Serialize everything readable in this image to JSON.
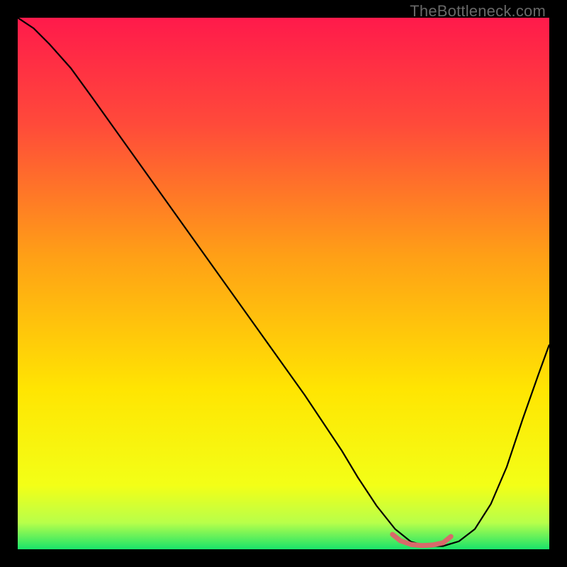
{
  "watermark": "TheBottleneck.com",
  "chart_data": {
    "type": "line",
    "title": "",
    "xlabel": "",
    "ylabel": "",
    "xlim": [
      0,
      100
    ],
    "ylim": [
      0,
      100
    ],
    "background_gradient": {
      "stops": [
        {
          "offset": 0.0,
          "color": "#ff1a4b"
        },
        {
          "offset": 0.2,
          "color": "#ff4a3a"
        },
        {
          "offset": 0.45,
          "color": "#ffa016"
        },
        {
          "offset": 0.7,
          "color": "#ffe502"
        },
        {
          "offset": 0.88,
          "color": "#f3ff17"
        },
        {
          "offset": 0.95,
          "color": "#b8ff4a"
        },
        {
          "offset": 1.0,
          "color": "#19e36a"
        }
      ]
    },
    "series": [
      {
        "name": "bottleneck-curve",
        "color": "#000000",
        "width": 2.2,
        "x": [
          0,
          3,
          6,
          10,
          14,
          18,
          22,
          26,
          30,
          34,
          38,
          42,
          46,
          50,
          54,
          58,
          61,
          64,
          67.5,
          71,
          74,
          77,
          80,
          83,
          86,
          89,
          92,
          95,
          98,
          100
        ],
        "y": [
          100,
          98,
          95,
          90.5,
          85,
          79.4,
          73.8,
          68.2,
          62.6,
          57,
          51.4,
          45.8,
          40.2,
          34.6,
          29,
          23,
          18.5,
          13.5,
          8.2,
          3.8,
          1.4,
          0.6,
          0.6,
          1.5,
          3.8,
          8.5,
          15.5,
          24.5,
          33,
          38.5
        ]
      }
    ],
    "highlight": {
      "name": "optimal-zone",
      "color": "#d86a6a",
      "width": 7,
      "x": [
        70.5,
        72,
        74,
        76,
        78,
        80,
        81.5
      ],
      "y": [
        2.8,
        1.6,
        0.9,
        0.7,
        0.8,
        1.2,
        2.4
      ]
    }
  }
}
